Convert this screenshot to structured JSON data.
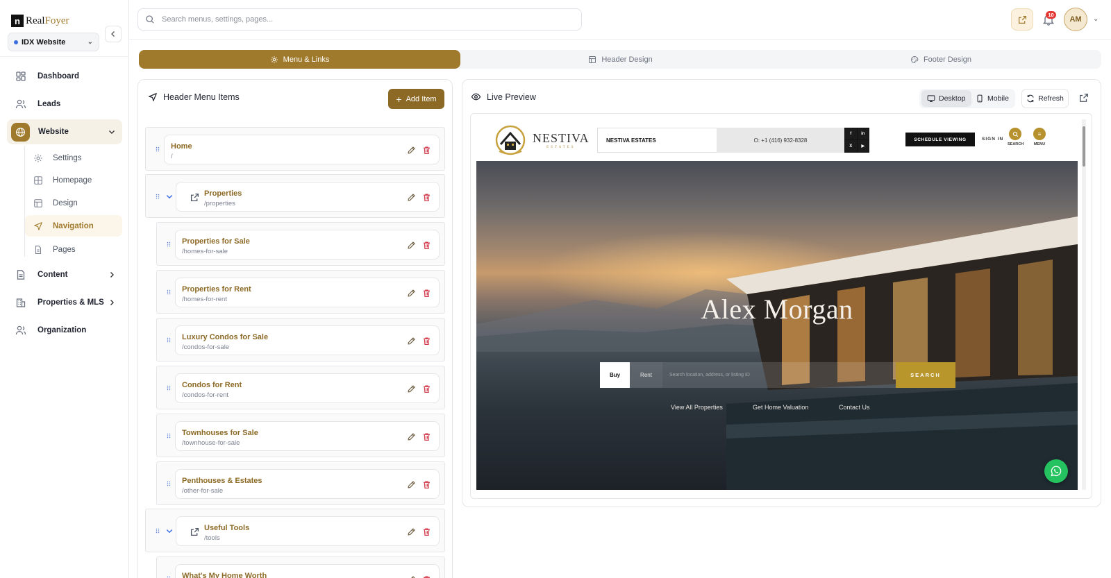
{
  "brand": {
    "mark": "n",
    "name_a": "Real",
    "name_b": "Foyer"
  },
  "site_selector": {
    "value": "IDX Website"
  },
  "sidebar": {
    "items": [
      {
        "label": "Dashboard"
      },
      {
        "label": "Leads"
      },
      {
        "label": "Website"
      },
      {
        "label": "Content"
      },
      {
        "label": "Properties & MLS"
      },
      {
        "label": "Organization"
      }
    ],
    "website_sub": [
      {
        "label": "Settings"
      },
      {
        "label": "Homepage"
      },
      {
        "label": "Design"
      },
      {
        "label": "Navigation"
      },
      {
        "label": "Pages"
      }
    ]
  },
  "topbar": {
    "search_placeholder": "Search menus, settings, pages...",
    "notifications": "10",
    "avatar": "AM"
  },
  "tabs": [
    {
      "label": "Menu & Links"
    },
    {
      "label": "Header Design"
    },
    {
      "label": "Footer Design"
    }
  ],
  "menu_panel": {
    "title": "Header Menu Items",
    "add_label": "Add Item",
    "items": [
      {
        "name": "Home",
        "path": "/"
      },
      {
        "name": "Properties",
        "path": "/properties"
      },
      {
        "name": "Properties for Sale",
        "path": "/homes-for-sale"
      },
      {
        "name": "Properties for Rent",
        "path": "/homes-for-rent"
      },
      {
        "name": "Luxury Condos for Sale",
        "path": "/condos-for-sale"
      },
      {
        "name": "Condos for Rent",
        "path": "/condos-for-rent"
      },
      {
        "name": "Townhouses for Sale",
        "path": "/townhouse-for-sale"
      },
      {
        "name": "Penthouses & Estates",
        "path": "/other-for-sale"
      },
      {
        "name": "Useful Tools",
        "path": "/tools"
      },
      {
        "name": "What's My Home Worth",
        "path": ""
      }
    ]
  },
  "preview": {
    "title": "Live Preview",
    "desktop_label": "Desktop",
    "mobile_label": "Mobile",
    "refresh_label": "Refresh",
    "site": {
      "logo_name": "NESTIVA",
      "logo_sub": "ESTATES",
      "estates_box": "NESTIVA ESTATES",
      "phone": "O:  +1 (416) 932-8328",
      "social": [
        "f",
        "in",
        "X",
        "▶"
      ],
      "schedule": "SCHEDULE VIEWING",
      "sign_in": "SIGN IN",
      "search_label": "SEARCH",
      "menu_label": "MENU",
      "hero_name": "Alex Morgan",
      "buy": "Buy",
      "rent": "Rent",
      "search_placeholder": "Search location, address, or listing ID",
      "search_btn": "SEARCH",
      "links": [
        "View All Properties",
        "Get Home Valuation",
        "Contact Us"
      ]
    }
  },
  "colors": {
    "accent": "#a07a2c",
    "accent_dark": "#8c6a26",
    "danger": "#d23a4b",
    "link_blue": "#3b6fe0"
  }
}
